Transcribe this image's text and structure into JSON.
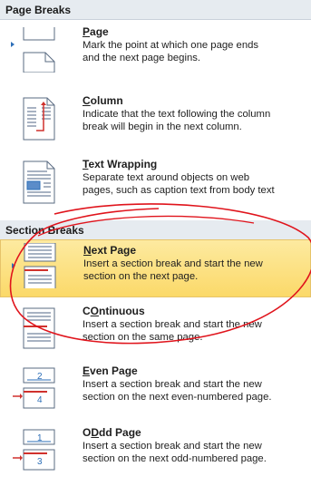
{
  "page_breaks": {
    "header": "Page Breaks",
    "items": [
      {
        "title_underlined": "P",
        "title_rest": "age",
        "desc": [
          "Mark the point at which one page ends",
          "and the next page begins."
        ],
        "icon": "page-break-icon"
      },
      {
        "title_underlined": "C",
        "title_rest": "olumn",
        "desc": [
          "Indicate that the text following the column",
          "break will begin in the next column."
        ],
        "icon": "column-break-icon"
      },
      {
        "title_underlined": "T",
        "title_rest": "ext Wrapping",
        "desc": [
          "Separate text around objects on web",
          "pages, such as caption text from body text"
        ],
        "icon": "text-wrapping-icon"
      }
    ]
  },
  "section_breaks": {
    "header": "Section Breaks",
    "items": [
      {
        "title_underlined": "N",
        "title_rest": "ext Page",
        "desc": [
          "Insert a section break and start the new",
          "section on the next page."
        ],
        "icon": "next-page-section-icon",
        "highlighted": true
      },
      {
        "title_underlined": "O",
        "title_rest": "ntinuous",
        "title_prefix": "C",
        "desc": [
          "Insert a section break and start the new",
          "section on the same page."
        ],
        "icon": "continuous-section-icon"
      },
      {
        "title_underlined": "E",
        "title_rest": "ven Page",
        "desc": [
          "Insert a section break and start the new",
          "section on the next even-numbered page."
        ],
        "icon": "even-page-section-icon",
        "icon_labels": [
          "2",
          "4"
        ]
      },
      {
        "title_underlined": "D",
        "title_prefix": "O",
        "title_rest": "d Page",
        "title_mid": "d",
        "desc": [
          "Insert a section break and start the new",
          "section on the next odd-numbered page."
        ],
        "icon": "odd-page-section-icon",
        "icon_labels": [
          "1",
          "3"
        ]
      }
    ]
  },
  "colors": {
    "highlight": "#fbd969",
    "annotation": "#e0141c",
    "header_bg": "#e6ebf0",
    "icon_blue": "#2d6fb8",
    "icon_red": "#d0312d"
  }
}
